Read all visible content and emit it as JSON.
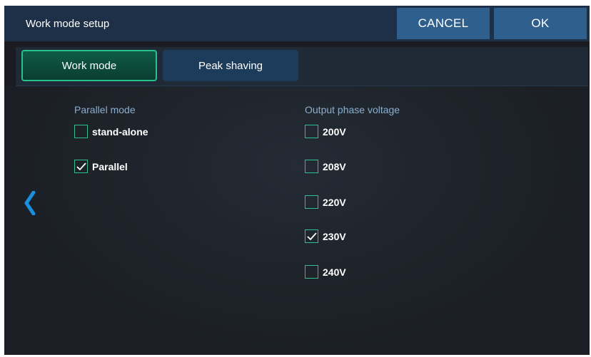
{
  "header": {
    "title": "Work mode setup",
    "cancel_label": "CANCEL",
    "ok_label": "OK"
  },
  "tabs": [
    {
      "label": "Work mode",
      "active": true
    },
    {
      "label": "Peak shaving",
      "active": false
    }
  ],
  "parallel": {
    "label": "Parallel mode",
    "options": [
      {
        "label": "stand-alone",
        "checked": false
      },
      {
        "label": "Parallel",
        "checked": true
      }
    ]
  },
  "voltage": {
    "label": "Output phase voltage",
    "options": [
      {
        "label": "200V",
        "checked": false
      },
      {
        "label": "208V",
        "checked": false
      },
      {
        "label": "220V",
        "checked": false
      },
      {
        "label": "230V",
        "checked": true
      },
      {
        "label": "240V",
        "checked": false
      }
    ]
  },
  "colors": {
    "accent_green": "#28c28c",
    "header_blue": "#2f5f8c",
    "arrow_blue": "#1a8fe0",
    "label_blue": "#8aaed0"
  },
  "icons": {
    "back": "chevron-left-icon",
    "check": "checkmark-icon"
  }
}
